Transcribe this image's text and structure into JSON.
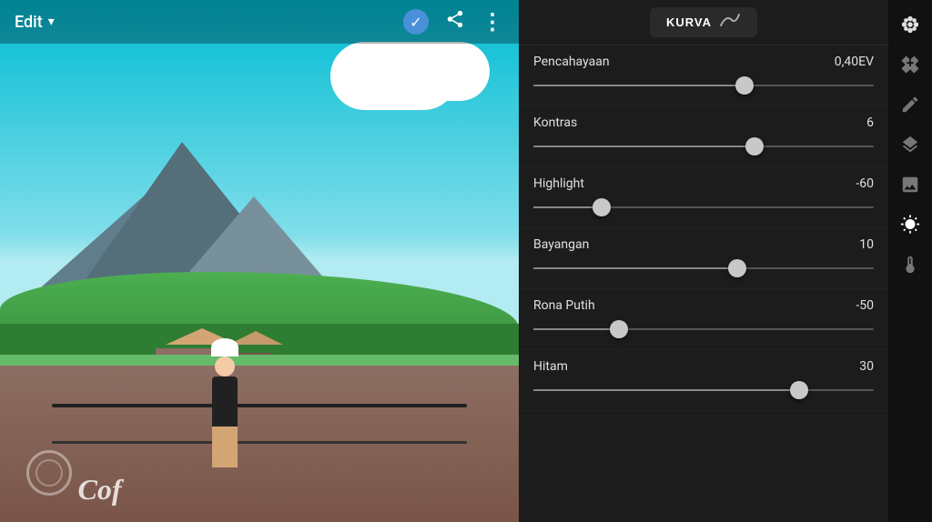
{
  "header": {
    "edit_label": "Edit",
    "more_icon": "⋮"
  },
  "sliders": [
    {
      "id": "pencahayaan",
      "label": "Pencahayaan",
      "value": "0,40EV",
      "position": 62,
      "fill": 62
    },
    {
      "id": "kontras",
      "label": "Kontras",
      "value": "6",
      "position": 65,
      "fill": 65
    },
    {
      "id": "highlight",
      "label": "Highlight",
      "value": "-60",
      "position": 20,
      "fill": 20
    },
    {
      "id": "bayangan",
      "label": "Bayangan",
      "value": "10",
      "position": 60,
      "fill": 60
    },
    {
      "id": "rona-putih",
      "label": "Rona Putih",
      "value": "-50",
      "position": 25,
      "fill": 25
    },
    {
      "id": "hitam",
      "label": "Hitam",
      "value": "30",
      "position": 78,
      "fill": 78
    }
  ],
  "kurva_button": "KURVA",
  "icons": [
    {
      "id": "flower",
      "symbol": "✿"
    },
    {
      "id": "bandage",
      "symbol": "🩹"
    },
    {
      "id": "crop",
      "symbol": "⊡"
    },
    {
      "id": "layers",
      "symbol": "❑"
    },
    {
      "id": "enhance",
      "symbol": "🖼"
    },
    {
      "id": "brightness",
      "symbol": "☀"
    },
    {
      "id": "temperature",
      "symbol": "🌡"
    }
  ]
}
